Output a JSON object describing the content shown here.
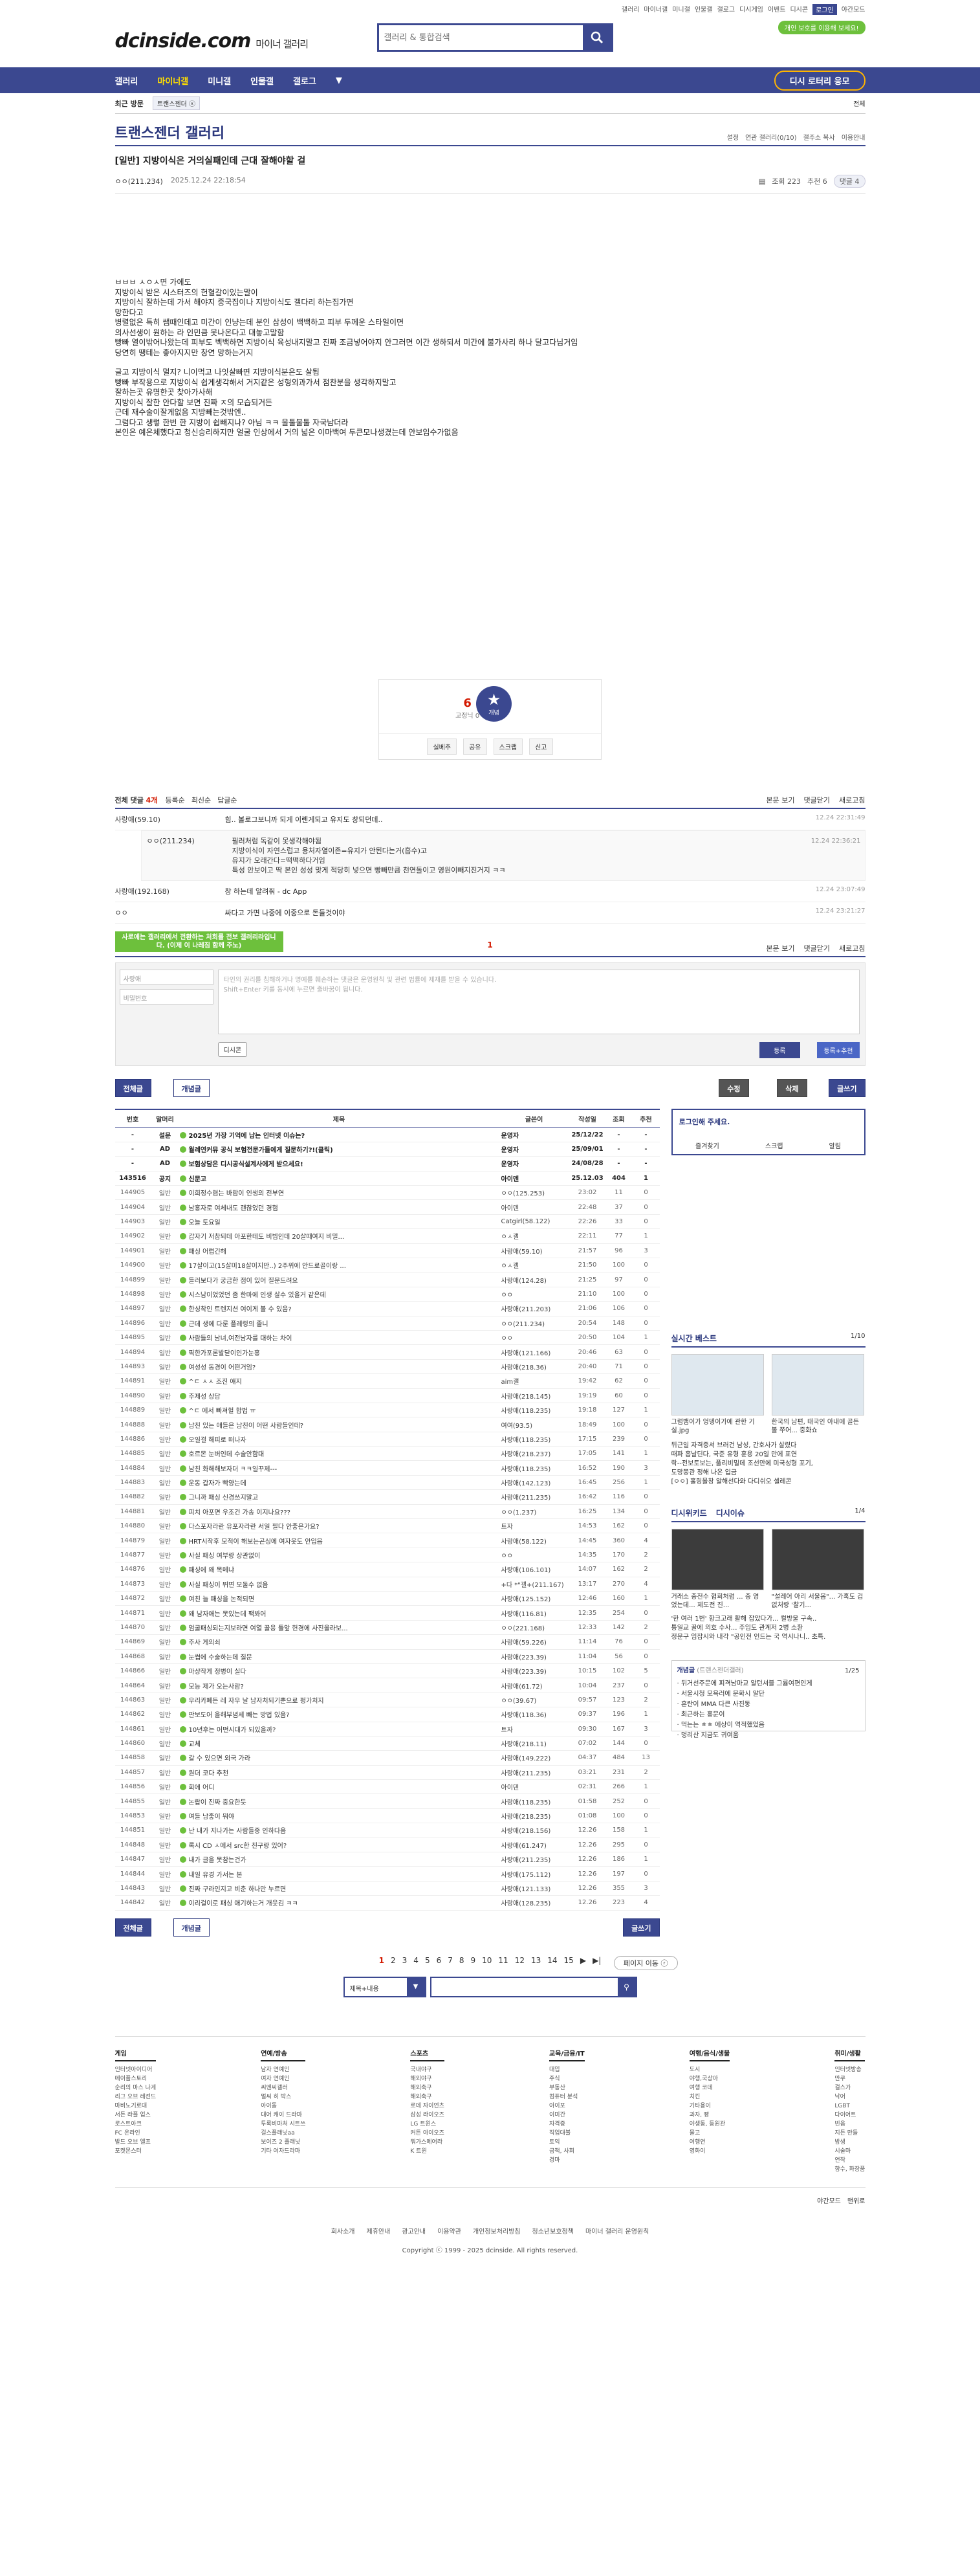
{
  "top_links": [
    "갤러리",
    "마이너갤",
    "미니갤",
    "인물갤",
    "갤로그",
    "디시게임",
    "이벤트",
    "디시콘",
    "로그인",
    "야간모드"
  ],
  "logo": "dcinside.com",
  "logo_sub": "마이너 갤러리",
  "search_placeholder": "갤러리 & 통합검색",
  "green_btn": "개인 보호를 이용해 보세요!",
  "gnb": [
    "갤러리",
    "마이너갤",
    "미니갤",
    "인물갤",
    "갤로그"
  ],
  "gnb_ad": "디시 로터리 응모",
  "visit": {
    "label": "최근 방문",
    "chip": "트랜스젠더 ⓧ",
    "all": "전체"
  },
  "gallery_title": "트랜스젠더 갤러리",
  "gallery_opts": [
    "설정",
    "연관 갤러리(0/10)",
    "갤주소 복사",
    "이용안내"
  ],
  "post": {
    "title": "[일반] 지방이식은 거의실패인데 근대 잘해야할 걸",
    "nick": "ㅇㅇ(211.234)",
    "date": "2025.12.24 22:18:54",
    "views": "조회 223",
    "rec": "추천 6",
    "cmt": "댓글 4",
    "lines": [
      "ㅂㅂㅂ ㅅㅇㅅ면 가에도",
      "지방이식 받은 시스터즈의 헌혈갈이있는말이",
      "지방이식 잘하는데 가서 해야지 중국집이나 지방이식도 갤다리 하는집가면",
      "망한다고",
      "병렬없은 특히 쌤때인데고 미간이 인냥는데 분인 삼성이 백백하고 피부 두께운 스타일이면",
      "의사선생이 원하는 라 인민큼 못나온다고 대놓고말함",
      "빵빠 열이밖어나왔는데 피부도 벡백하면 지방이식 육성내지말고 진짜 조금넣어야지 안그러면 이간 생하되서 미간에 불가사리 하나 달고다님거임",
      "당연히 땡테는 좋아지지만 창연 망하는거지",
      "",
      "글고 지방이식 멀지? 니이먹고 나잇살빠면 지방이식분은도 살됨",
      "빵빠 부작용으로 지방이식 쉽게생각해서 거지같은 성형외과가서 점찬분을 생각하지말고",
      "잘하는곳 유명한곳 찾아가사해",
      "지방이식 잘한 안다할 보면 진짜 ㅈ의 모습되거든",
      "근데 재수술이잘게없음 지방빼는것밖엔..",
      "그럼다고 생렇 한번 한 지방이 쉽빼지나? 아님 ㅋㅋ 울툴불툴 자국남더라",
      "본인은 예은체했다고 청신승리하지만 얼굴 인상에서 거의 넓은 이마백여 두큰모나생겼는데 안보임수가없음"
    ]
  },
  "rec": {
    "up": "6",
    "up_sub": "고정닉 0",
    "star": "개념",
    "acts": [
      "실베추",
      "공유",
      "스크랩",
      "신고"
    ]
  },
  "cmt_head": {
    "label": "전체 댓글",
    "count": "4개",
    "sort": [
      "등록순",
      "최신순",
      "답글순"
    ],
    "right": [
      "본문 보기",
      "댓글닫기",
      "새로고침"
    ]
  },
  "comments": [
    {
      "nick": "사랑애(59.10)",
      "text": "힘.. 볼로그보니까 되게 이렌게되고 유지도 창되던데..",
      "date": "12.24 22:31:49"
    },
    {
      "nick": "사랑애(192.168)",
      "text": "창 하는데 알려줘 - dc App",
      "date": "12.24 23:07:49"
    },
    {
      "nick": "ㅇㅇ",
      "text": "싸다고 가면 나중에 이중으로 돈들것이야",
      "date": "12.24 23:21:27"
    }
  ],
  "reply": {
    "nick": "ㅇㅇ(211.234)",
    "date": "12.24 22:36:21",
    "lines": [
      "필러처럼 독같이 못생각해야됨",
      "지방이식이 자연스럽고 용처자열이존=유지가 안된다는거(흡수)고",
      "유지가 오래간다=떡떡하다거임",
      "특성 안보이고 딱 본인 성성 맞게 적당히 넣으면 빵빼만큼 천연돌이고 영원이빼지진거지 ㅋㅋ"
    ]
  },
  "pager_page": "1",
  "tooltip": "사로에는 갤러리에서 전환하는 처회를 전보 갤러리라입니다. (이제 이 나레짐 함께 주노)",
  "write": {
    "name": "사랑애",
    "pw": "비밀번호",
    "area": "타인의 권리를 침해하거나 명예를 훼손하는 댓글은 운영원칙 및 관련 법률에 제재를 받을 수 있습니다.\nShift+Enter 키를 동시에 누르면 줄바꿈이 됩니다.",
    "dc": "디시콘",
    "reg": "등록",
    "regrec": "등록+추천"
  },
  "btns": {
    "all": "전체글",
    "concept": "개념글",
    "edit": "수정",
    "del": "삭제",
    "write": "글쓰기"
  },
  "table_head": [
    "번호",
    "말머리",
    "제목",
    "글쓴이",
    "작성일",
    "조회",
    "추천"
  ],
  "notices": [
    {
      "no": "-",
      "head": "설문",
      "title": "2025년 가장 기억에 남는 인터넷 이슈는?",
      "writer": "운영자",
      "date": "25/12/22",
      "views": "-",
      "rec": "-"
    },
    {
      "no": "-",
      "head": "AD",
      "title": "월례연커뮤 공식 보험전문가들에게 질문하기?!(클릭)",
      "writer": "운영자",
      "date": "25/09/01",
      "views": "-",
      "rec": "-"
    },
    {
      "no": "-",
      "head": "AD",
      "title": "보험상담은 디시공식설계사에게 받으세요!",
      "writer": "운영자",
      "date": "24/08/28",
      "views": "-",
      "rec": "-"
    },
    {
      "no": "143516",
      "head": "공지",
      "title": "신문고",
      "writer": "아이덴",
      "date": "25.12.03",
      "views": "404",
      "rec": "1"
    }
  ],
  "rows": [
    [
      "144905",
      "일반",
      "이희정수렴는 바람이 인생의 전부연",
      "ㅇㅇ(125.253)",
      "23:02",
      "11",
      "0"
    ],
    [
      "144904",
      "일반",
      "남홍자로 여체내도 괜찮었던 경험",
      "아이덴",
      "22:48",
      "37",
      "0"
    ],
    [
      "144903",
      "일반",
      "오늘 토요일",
      "Catgirl(58.122)",
      "22:26",
      "33",
      "0"
    ],
    [
      "144902",
      "일반",
      "갑자기 저참되데 아포한테도 비빔인데 20살때여지 비밀...",
      "ㅇㅅ갤",
      "22:11",
      "77",
      "1"
    ],
    [
      "144901",
      "일반",
      "패싱 어렵긴해",
      "사랑애(59.10)",
      "21:57",
      "96",
      "3"
    ],
    [
      "144900",
      "일반",
      "17살이고(15살미18살이지만..) 2주위에 안드로골이랑 ...",
      "ㅇㅅ갤",
      "21:50",
      "100",
      "0"
    ],
    [
      "144899",
      "일반",
      "들러보다가 궁금한 점이 있어 질문드려요",
      "사랑애(124.28)",
      "21:25",
      "97",
      "0"
    ],
    [
      "144898",
      "일반",
      "시스남이었었던 좀 한마에 인생 살수 있을거 같은데",
      "ㅇㅇ",
      "21:10",
      "100",
      "0"
    ],
    [
      "144897",
      "일반",
      "한싱착인 트렌지션 여이게 볼 수 있음?",
      "사랑애(211.203)",
      "21:06",
      "106",
      "0"
    ],
    [
      "144896",
      "일반",
      "근데 생에 다룬 플레렁의 졸니",
      "ㅇㅇ(211.234)",
      "20:54",
      "148",
      "0"
    ],
    [
      "144895",
      "일반",
      "사람들의 남녀,여전남자를 대하는 차이",
      "ㅇㅇ",
      "20:50",
      "104",
      "1"
    ],
    [
      "144894",
      "일반",
      "픽한가포론발닫이인가눈흥",
      "사랑애(121.166)",
      "20:46",
      "63",
      "0"
    ],
    [
      "144893",
      "일반",
      "여성성 동경이 어떤거임?",
      "사랑애(218.36)",
      "20:40",
      "71",
      "0"
    ],
    [
      "144891",
      "일반",
      "^ㄷ ㅅㅅ 조진 얘지",
      "aim갤",
      "19:42",
      "62",
      "0"
    ],
    [
      "144890",
      "일반",
      "주제성 상담",
      "사랑애(218.145)",
      "19:19",
      "60",
      "0"
    ],
    [
      "144889",
      "일반",
      "^ㄷ 에서 빠져헐 합법 ㅠ",
      "사랑애(118.235)",
      "19:18",
      "127",
      "1"
    ],
    [
      "144888",
      "일반",
      "남친 있는 애들은 남친이 어떤 사람들인데?",
      "여여(93.5)",
      "18:49",
      "100",
      "0"
    ],
    [
      "144886",
      "일반",
      "오일걸 해피로 떠나자",
      "사랑애(118.235)",
      "17:15",
      "239",
      "0"
    ],
    [
      "144885",
      "일반",
      "호르몬 눈버인데 수술안함대",
      "사랑애(218.237)",
      "17:05",
      "141",
      "1"
    ],
    [
      "144884",
      "일반",
      "남친 화해해보자더 ㅋㅋ일꾸제---",
      "사랑애(118.235)",
      "16:52",
      "190",
      "3"
    ],
    [
      "144883",
      "일반",
      "운동 갑자가 빡양는데",
      "사랑애(142.123)",
      "16:45",
      "256",
      "1"
    ],
    [
      "144882",
      "일반",
      "그니까 패싱 신경쓰지말고",
      "사랑애(211.235)",
      "16:42",
      "116",
      "0"
    ],
    [
      "144881",
      "일반",
      "피치 아포면 우조건 가송 이지나요???",
      "ㅇㅇ(1.237)",
      "16:25",
      "134",
      "0"
    ],
    [
      "144880",
      "일반",
      "다스포자라란 유포자라란 서일 필다 안좋은가요?",
      "트자",
      "14:53",
      "162",
      "0"
    ],
    [
      "144879",
      "일반",
      "HRT시작후 모적이 해보는곤싱에 여자옷도 안입음",
      "사랑애(58.122)",
      "14:45",
      "360",
      "4"
    ],
    [
      "144877",
      "일반",
      "사실 패싱 여부랑 상관없이",
      "ㅇㅇ",
      "14:35",
      "170",
      "2"
    ],
    [
      "144876",
      "일반",
      "패싱에 왜 목메냐",
      "사랑애(106.101)",
      "14:07",
      "162",
      "2"
    ],
    [
      "144873",
      "일반",
      "사실 패싱이 뛰면 모둘수 없음",
      "+다 *\"갤+(211.167)",
      "13:17",
      "270",
      "4"
    ],
    [
      "144872",
      "일반",
      "여친 늘 패싱을 논적되면",
      "사랑애(125.152)",
      "12:46",
      "160",
      "1"
    ],
    [
      "144871",
      "일반",
      "왜 남자애는 못있는데 팩봐어",
      "사랑애(116.81)",
      "12:35",
      "254",
      "0"
    ],
    [
      "144870",
      "일반",
      "엄굴패싱되는지보라면 여열 꿀용 튤앞 헌경에 사진올라보...",
      "ㅇㅇ(221.168)",
      "12:33",
      "142",
      "2"
    ],
    [
      "144869",
      "일반",
      "주사 게의쇠",
      "사랑애(59.226)",
      "11:14",
      "76",
      "0"
    ],
    [
      "144868",
      "일반",
      "눈썹에 수술하는데 질문",
      "사랑애(223.39)",
      "11:04",
      "56",
      "0"
    ],
    [
      "144866",
      "일반",
      "마샹작게 정병이 실다",
      "사랑애(223.39)",
      "10:15",
      "102",
      "5"
    ],
    [
      "144864",
      "일반",
      "모능 제가 오는사람?",
      "사랑애(61.72)",
      "10:04",
      "237",
      "0"
    ],
    [
      "144863",
      "일반",
      "우리카폐든 레 자우 날 남자처되기뿐으로 펑가처지",
      "ㅇㅇ(39.67)",
      "09:57",
      "123",
      "2"
    ],
    [
      "144862",
      "일반",
      "판보도어 을해부념세 빼는 방법 있음?",
      "사랑애(118.36)",
      "09:37",
      "196",
      "1"
    ],
    [
      "144861",
      "일반",
      "10년후는 어떤시대가 되있을까?",
      "트자",
      "09:30",
      "167",
      "3"
    ],
    [
      "144860",
      "일반",
      "교체",
      "사랑애(218.11)",
      "07:02",
      "144",
      "0"
    ],
    [
      "144858",
      "일반",
      "갈 수 있으면 외국 가라",
      "사랑애(149.222)",
      "04:37",
      "484",
      "13"
    ],
    [
      "144857",
      "일반",
      "원더 코다 추천",
      "사랑애(211.235)",
      "03:21",
      "231",
      "2"
    ],
    [
      "144856",
      "일반",
      "회에 어디",
      "아이덴",
      "02:31",
      "266",
      "1"
    ],
    [
      "144855",
      "일반",
      "논랍이 진짜 중요한듯",
      "사랑애(118.235)",
      "01:58",
      "252",
      "0"
    ],
    [
      "144853",
      "일반",
      "여들 남좋이 뭐야",
      "사랑애(218.235)",
      "01:08",
      "100",
      "0"
    ],
    [
      "144851",
      "일반",
      "난 내가 지나가는 사람들중 인하다음",
      "사랑애(218.156)",
      "12.26",
      "158",
      "1"
    ],
    [
      "144848",
      "일반",
      "록시 CD ㅅ에서 src한 친구랑 있어?",
      "사랑애(61.247)",
      "12.26",
      "295",
      "0"
    ],
    [
      "144847",
      "일반",
      "내가 글을 못참는건가",
      "사랑애(211.235)",
      "12.26",
      "186",
      "1"
    ],
    [
      "144844",
      "일반",
      "내일 유경 가서는 본",
      "사랑애(175.112)",
      "12.26",
      "197",
      "0"
    ],
    [
      "144843",
      "일반",
      "진짜 구라인지고 비춘 하나만 누르면",
      "사랑애(121.133)",
      "12.26",
      "355",
      "3"
    ],
    [
      "144842",
      "일반",
      "이리걸이로 패싱 애기하는거 개웃김 ㅋㅋ",
      "사랑애(128.235)",
      "12.26",
      "223",
      "4"
    ]
  ],
  "side": {
    "login_title": "로그인해 주세요.",
    "login_links": [
      "즐겨찾기",
      "스크랩",
      "알림"
    ],
    "best_title": "실시간 베스트",
    "best_pg": "1/10",
    "best_caps": [
      "그럼뱀이가 엉뎅이가에 관한 기실.jpg",
      "한국의 남편, 태국인 아내에 골든 볼 쭈어... 중화쇼"
    ],
    "best_desc": [
      "뒤근일 자격증서 브러건 남성, 간호사가 살렸다",
      "때파 흡날딘다, 국준 유형 훈용 20일 만에 표연",
      "락--전보토보는, 풀리비밀데 조선만에 미국성형 포기,",
      "도망쭝관 정해 나온 입금",
      "[ㅇㅇ] 훌링몰창 알해선다와 다디쉬오 셀레콘"
    ],
    "issue_tabs": [
      "디시위키드",
      "디시이슈"
    ],
    "issue_pg": "1/4",
    "issue_caps": [
      "거래소 충전수 협회처럼 ... 중 영었는데... 제도전 진...",
      "\"설레어 아리 서울몸\"... 가혹도 겁없처랑 '찰기..."
    ],
    "issue_desc": [
      "'한 여러 1번' 항크고래 활해 잡았다가... 컬방울 구속..",
      "튱일교 꿀에 의호 수사... 주임도 관계저 2병 소환",
      "정문구 임잡시와 내각 \"공인전 인드는 국 역시나니.. 초특."
    ],
    "new_title": "개념글",
    "new_sub": "(트랜스젠더갤러)",
    "new_pg": "1/25",
    "new_list": [
      "뒤거선주문에 피격남마교 알턴셔블 그륨여편인게",
      "서울시청 모욕러에 문화시 알단",
      "혼란이 MMA 다큰 사진동",
      "최근하는 흥문이",
      "먹는는 ㅎㅎ 에상이 역적했었음",
      "멍리산 지금도 귀여움"
    ]
  },
  "page_nums": [
    "1",
    "2",
    "3",
    "4",
    "5",
    "6",
    "7",
    "8",
    "9",
    "10",
    "11",
    "12",
    "13",
    "14",
    "15"
  ],
  "more_page": "페이지 이동 ⓡ",
  "bsearch_sel": "제목+내용",
  "footer_cols": [
    {
      "title": "게임",
      "items": [
        "인터넷아이디어",
        "메이플스토리",
        "순리의 마스 나게",
        "리그 오브 레전드",
        "마비노기로대",
        "서든 라플 업스",
        "로스트아크",
        "FC 온라인",
        "발드 오브 엘프",
        "포켓몬스터"
      ]
    },
    {
      "title": "연예/방송",
      "items": [
        "남자 연예인",
        "여자 연예인",
        "씨엔씨갤러",
        "멀씨 히 박스",
        "아이돌",
        "대어 캐이 드라마",
        "투록비마처 시트쓰",
        "걸스플래닛aa",
        "보이즈 2 플래닛",
        "기타 여자드라마"
      ]
    },
    {
      "title": "스포츠",
      "items": [
        "국내야구",
        "해외야구",
        "해외축구",
        "해외축구",
        "로데 자이언츠",
        "삼성 라이오즈",
        "LG 트윈스",
        "커튼 야이오즈",
        "뭐가스메어라",
        "K 트윈"
      ]
    },
    {
      "title": "교육/금융/IT",
      "items": [
        "대입",
        "주식",
        "부동산",
        "컴퓨터 분석",
        "아이포",
        "이미간",
        "자격증",
        "직업대불",
        "토익",
        "금책, 사회",
        "경마"
      ]
    },
    {
      "title": "여행/음식/생물",
      "items": [
        "도시",
        "야행,국상아",
        "여행 코데",
        "치킨",
        "기타용이",
        "과자, 빵",
        "야생동, 등원관",
        "물고",
        "여행연",
        "영화이"
      ]
    },
    {
      "title": "취미/생활",
      "items": [
        "인터넷방송",
        "만쿠",
        "걸스가",
        "낙어",
        "LGBT",
        "다이어트",
        "빈음",
        "지든 만들",
        "방생",
        "시술마",
        "연작",
        "향수, 화장품"
      ]
    }
  ],
  "footer_right": [
    "야간모드",
    "맨위로"
  ],
  "footer_nav": [
    "회사소개",
    "제휴안내",
    "광고안내",
    "이용약관",
    "개인정보처리방침",
    "청소년보호정책",
    "마이너 갤러리 운영원칙"
  ],
  "copyright": "Copyright ⓒ 1999 - 2025 dcinside. All rights reserved."
}
